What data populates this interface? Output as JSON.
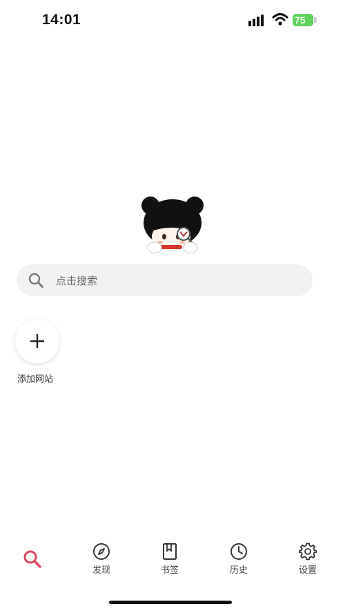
{
  "status_bar": {
    "time": "14:01",
    "battery": "75"
  },
  "search": {
    "placeholder": "点击搜索"
  },
  "shortcut": {
    "add_label": "添加网站"
  },
  "bottom_nav": {
    "active": "search",
    "accent_color": "#d9455f",
    "items": [
      {
        "label": "",
        "icon": "search-icon"
      },
      {
        "label": "发现",
        "icon": "compass-icon"
      },
      {
        "label": "书签",
        "icon": "bookmark-icon"
      },
      {
        "label": "历史",
        "icon": "clock-icon"
      },
      {
        "label": "设置",
        "icon": "gear-icon"
      }
    ]
  }
}
